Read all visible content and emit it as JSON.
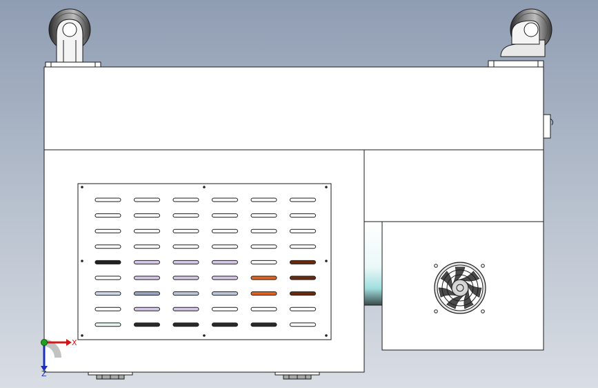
{
  "view": {
    "background_top": "#8f9db3",
    "background_bottom": "#d9dde4",
    "line_color": "#1a1a1a",
    "body_fill": "#ffffff"
  },
  "triad": {
    "x_label": "X",
    "z_label": "Z",
    "x_color": "#d01818",
    "y_color": "#20a020",
    "z_color": "#1c2fb8"
  },
  "icons": {
    "caster_left": "caster-wheel-icon",
    "caster_right": "caster-wheel-icon",
    "fan": "fan-grille-icon"
  },
  "vent": {
    "rows": 9,
    "columns": 6,
    "accent_color": "#e0641e"
  }
}
